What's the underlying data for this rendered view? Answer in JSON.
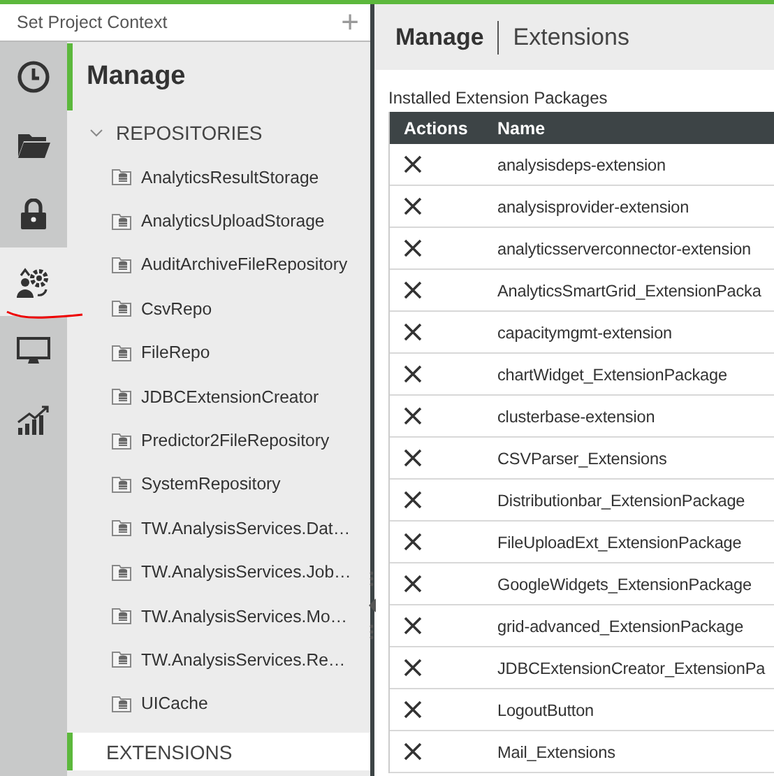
{
  "project_context": {
    "placeholder": "Set Project Context",
    "add_icon": "+"
  },
  "rail": [
    {
      "kind": "clock",
      "selected": false
    },
    {
      "kind": "folder",
      "selected": false
    },
    {
      "kind": "lock",
      "selected": false
    },
    {
      "kind": "users-gear",
      "selected": true
    },
    {
      "kind": "monitor",
      "selected": false
    },
    {
      "kind": "chart",
      "selected": false
    }
  ],
  "nav": {
    "title": "Manage",
    "sections": [
      {
        "label": "REPOSITORIES",
        "expanded": true,
        "selected": false,
        "children": [
          {
            "label": "AnalyticsResultStorage"
          },
          {
            "label": "AnalyticsUploadStorage"
          },
          {
            "label": "AuditArchiveFileRepository"
          },
          {
            "label": "CsvRepo"
          },
          {
            "label": "FileRepo"
          },
          {
            "label": "JDBCExtensionCreator"
          },
          {
            "label": "Predictor2FileRepository"
          },
          {
            "label": "SystemRepository"
          },
          {
            "label": "TW.AnalysisServices.Dat…"
          },
          {
            "label": "TW.AnalysisServices.Job…"
          },
          {
            "label": "TW.AnalysisServices.Mo…"
          },
          {
            "label": "TW.AnalysisServices.Re…"
          },
          {
            "label": "UICache"
          }
        ]
      },
      {
        "label": "EXTENSIONS",
        "expanded": false,
        "selected": true
      }
    ]
  },
  "header": {
    "title": "Manage",
    "subtitle": "Extensions"
  },
  "table": {
    "caption": "Installed Extension Packages",
    "columns": [
      "Actions",
      "Name"
    ],
    "rows": [
      {
        "name": "analysisdeps-extension"
      },
      {
        "name": "analysisprovider-extension"
      },
      {
        "name": "analyticsserverconnector-extension"
      },
      {
        "name": "AnalyticsSmartGrid_ExtensionPacka"
      },
      {
        "name": "capacitymgmt-extension"
      },
      {
        "name": "chartWidget_ExtensionPackage"
      },
      {
        "name": "clusterbase-extension"
      },
      {
        "name": "CSVParser_Extensions"
      },
      {
        "name": "Distributionbar_ExtensionPackage"
      },
      {
        "name": "FileUploadExt_ExtensionPackage"
      },
      {
        "name": "GoogleWidgets_ExtensionPackage"
      },
      {
        "name": "grid-advanced_ExtensionPackage"
      },
      {
        "name": "JDBCExtensionCreator_ExtensionPa"
      },
      {
        "name": "LogoutButton"
      },
      {
        "name": "Mail_Extensions"
      }
    ]
  }
}
